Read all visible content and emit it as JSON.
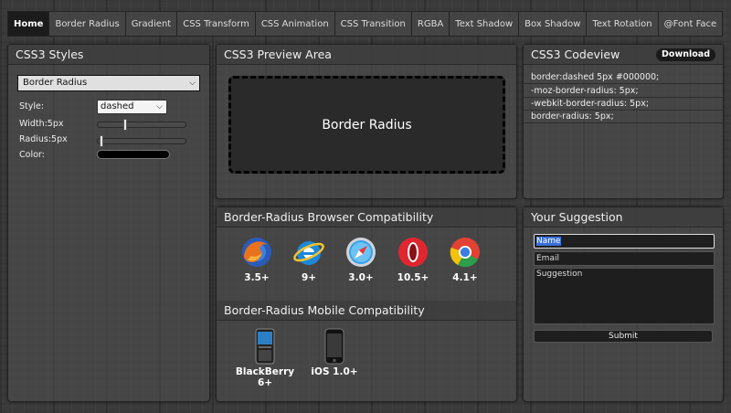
{
  "nav": {
    "tabs": [
      "Home",
      "Border Radius",
      "Gradient",
      "CSS Transform",
      "CSS Animation",
      "CSS Transition",
      "RGBA",
      "Text Shadow",
      "Box Shadow",
      "Text Rotation",
      "@Font Face"
    ],
    "active": "Home"
  },
  "styles": {
    "title": "CSS3 Styles",
    "effect_select": "Border Radius",
    "style_label": "Style:",
    "style_value": "dashed",
    "width_label": "Width:5px",
    "width_level": 0.3,
    "radius_label": "Radius:5px",
    "radius_level": 0.02,
    "color_label": "Color:",
    "color_value": "#000000"
  },
  "preview": {
    "title": "CSS3 Preview Area",
    "box_text": "Border Radius"
  },
  "codeview": {
    "title": "CSS3 Codeview",
    "download_label": "Download",
    "lines": [
      "border:dashed 5px #000000;",
      "-moz-border-radius: 5px;",
      "-webkit-border-radius: 5px;",
      "border-radius: 5px;"
    ]
  },
  "compat": {
    "browser_title": "Border-Radius Browser Compatibility",
    "browsers": [
      {
        "name": "firefox-icon",
        "version": "3.5+"
      },
      {
        "name": "ie-icon",
        "version": "9+"
      },
      {
        "name": "safari-icon",
        "version": "3.0+"
      },
      {
        "name": "opera-icon",
        "version": "10.5+"
      },
      {
        "name": "chrome-icon",
        "version": "4.1+"
      }
    ],
    "mobile_title": "Border-Radius Mobile Compatibility",
    "mobile": [
      {
        "name": "blackberry-icon",
        "version_line1": "BlackBerry",
        "version_line2": "6+"
      },
      {
        "name": "iphone-icon",
        "version_line1": "iOS 1.0+",
        "version_line2": ""
      }
    ]
  },
  "suggestion": {
    "title": "Your Suggestion",
    "name_value": "Name",
    "email_value": "Email",
    "suggestion_value": "Suggestion",
    "submit_label": "Submit"
  },
  "colors": {
    "accent_selection": "#3a6fd8",
    "active_tab": "#1b1b1b"
  }
}
